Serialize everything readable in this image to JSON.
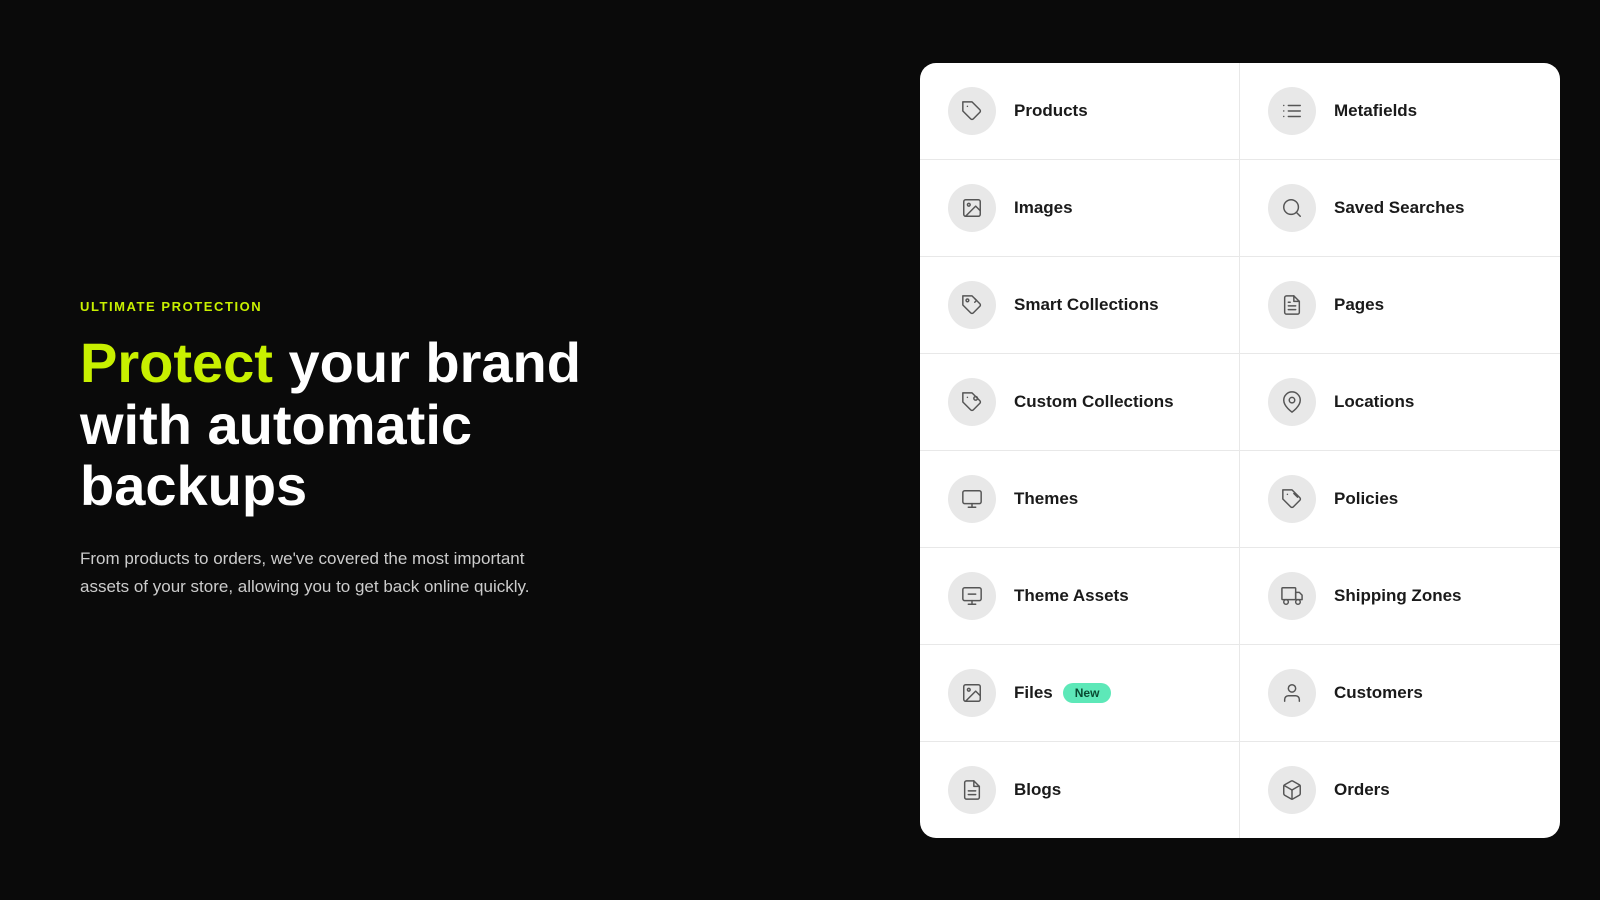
{
  "left": {
    "eyebrow": "ULTIMATE PROTECTION",
    "headline_part1": "Protect",
    "headline_part2": " your brand\nwith automatic backups",
    "description": "From products to orders, we've covered the most important assets of your store, allowing you to get back online quickly."
  },
  "grid": {
    "items": [
      {
        "id": "products",
        "label": "Products",
        "icon": "tag",
        "badge": null,
        "col": 1
      },
      {
        "id": "metafields",
        "label": "Metafields",
        "icon": "list",
        "badge": null,
        "col": 2
      },
      {
        "id": "images",
        "label": "Images",
        "icon": "image",
        "badge": null,
        "col": 1
      },
      {
        "id": "saved-searches",
        "label": "Saved Searches",
        "icon": "search",
        "badge": null,
        "col": 2
      },
      {
        "id": "smart-collections",
        "label": "Smart Collections",
        "icon": "smart-collection",
        "badge": null,
        "col": 1
      },
      {
        "id": "pages",
        "label": "Pages",
        "icon": "pages",
        "badge": null,
        "col": 2
      },
      {
        "id": "custom-collections",
        "label": "Custom Collections",
        "icon": "custom-collection",
        "badge": null,
        "col": 1
      },
      {
        "id": "locations",
        "label": "Locations",
        "icon": "location",
        "badge": null,
        "col": 2
      },
      {
        "id": "themes",
        "label": "Themes",
        "icon": "theme",
        "badge": null,
        "col": 1
      },
      {
        "id": "policies",
        "label": "Policies",
        "icon": "policies",
        "badge": null,
        "col": 2
      },
      {
        "id": "theme-assets",
        "label": "Theme Assets",
        "icon": "theme-assets",
        "badge": null,
        "col": 1
      },
      {
        "id": "shipping-zones",
        "label": "Shipping Zones",
        "icon": "shipping",
        "badge": null,
        "col": 2
      },
      {
        "id": "files",
        "label": "Files",
        "icon": "files",
        "badge": "New",
        "col": 1
      },
      {
        "id": "customers",
        "label": "Customers",
        "icon": "customer",
        "badge": null,
        "col": 2
      },
      {
        "id": "blogs",
        "label": "Blogs",
        "icon": "blogs",
        "badge": null,
        "col": 1
      },
      {
        "id": "orders",
        "label": "Orders",
        "icon": "orders",
        "badge": null,
        "col": 2
      }
    ]
  }
}
